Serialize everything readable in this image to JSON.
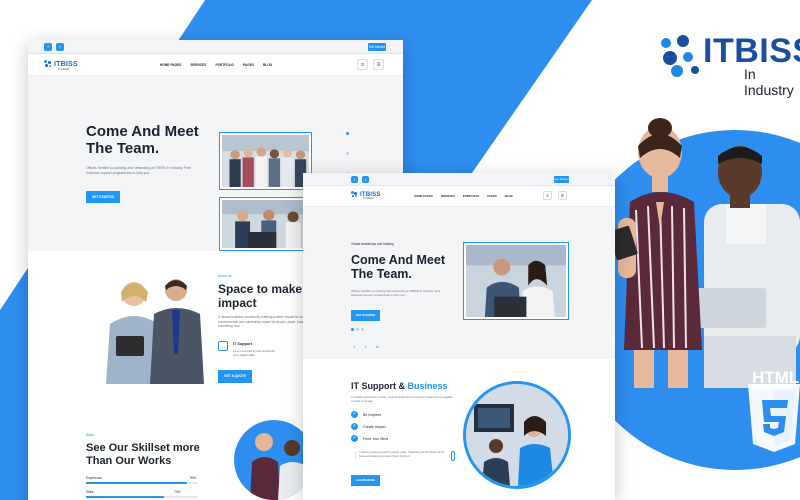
{
  "brand": {
    "name": "ITBISS",
    "subtitle": "In Industry",
    "badge": "HTML"
  },
  "colors": {
    "accent": "#2196f3",
    "accent_dark": "#1565c0",
    "brand_text": "#1a4fa0",
    "hero_bg": "#f4f5f7",
    "stripe": "#2e8ef0"
  },
  "back_mockup": {
    "topbar": {
      "icons": [
        "facebook-icon",
        "twitter-icon"
      ],
      "cta": "Get Started"
    },
    "logo": {
      "name": "ITBISS",
      "sub": "In Industry"
    },
    "menu": [
      "HOME PAGES",
      "SERVICES",
      "PORTFOLIO",
      "PAGES",
      "BLOG"
    ],
    "hero": {
      "title_line1": "Come And Meet",
      "title_line2": "The Team.",
      "text": "Offices, flexible co-working and networking at ITBISS In Industry. Free business support programmes to help you.",
      "button": "GET STARTED"
    },
    "about": {
      "label": "About us",
      "title_line1": "Space to make",
      "title_line2": "impact",
      "text": "A vibrant business community creating positive impact for social, environmental and community impact for people, place. Learn something new.",
      "feature_title": "IT Support",
      "feature_text": "Learn something new and build your digital skills",
      "button": "GET A QUOTE"
    },
    "skills": {
      "label": "Skills",
      "title_line1": "See Our Skillset more",
      "title_line2": "Than Our Works",
      "bars": [
        {
          "label": "Experience",
          "value": 90,
          "display": "90%"
        },
        {
          "label": "Skills",
          "value": 70,
          "display": "70%"
        }
      ]
    }
  },
  "front_mockup": {
    "topbar": {
      "icons": [
        "facebook-icon",
        "twitter-icon"
      ],
      "cta": "Get Started"
    },
    "logo": {
      "name": "ITBISS",
      "sub": "In Industry"
    },
    "menu": [
      "HOME PAGES",
      "SERVICES",
      "PORTFOLIO",
      "PAGES",
      "BLOG"
    ],
    "hero": {
      "eyebrow": "Virtual workshops and training",
      "title_line1": "Come And Meet",
      "title_line2": "The Team.",
      "text": "Offices, flexible co-working and networking at ITBISS In Industry. Free business support programmes to help you.",
      "button": "GET STARTED",
      "social": [
        "f",
        "t",
        "in"
      ]
    },
    "support": {
      "title_a": "IT Support &",
      "title_b": "Business",
      "text": "A creative process for social, environmental and community impact on the capable comfort of a page.",
      "checks": [
        "Be Inspired",
        "Create Impact",
        "Feed Your Mind"
      ],
      "quote": "Creating positive impact for people, place, networking for the drivers of the future and business creation that is future of.",
      "button": "LEARN MORE"
    }
  }
}
